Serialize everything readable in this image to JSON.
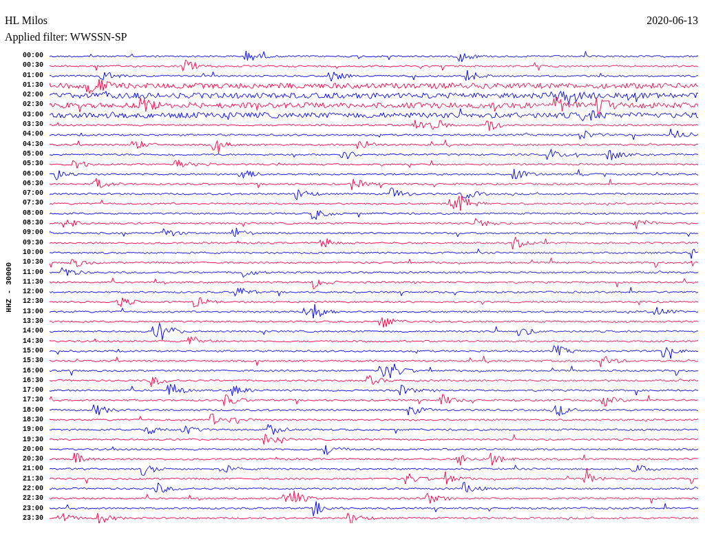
{
  "header": {
    "station": "HL Milos",
    "date": "2020-06-13",
    "filter": "Applied filter: WWSSN-SP"
  },
  "channel_label": "HHZ - 30000",
  "rows": [
    "00:00",
    "00:30",
    "01:00",
    "01:30",
    "02:00",
    "02:30",
    "03:00",
    "03:30",
    "04:00",
    "04:30",
    "05:00",
    "05:30",
    "06:00",
    "06:30",
    "07:00",
    "07:30",
    "08:00",
    "08:30",
    "09:00",
    "09:30",
    "10:00",
    "10:30",
    "11:00",
    "11:30",
    "12:00",
    "12:30",
    "13:00",
    "13:30",
    "14:00",
    "14:30",
    "15:00",
    "15:30",
    "16:00",
    "16:30",
    "17:00",
    "17:30",
    "18:00",
    "18:30",
    "19:00",
    "19:30",
    "20:00",
    "20:30",
    "21:00",
    "21:30",
    "22:00",
    "22:30",
    "23:00",
    "23:30"
  ]
}
